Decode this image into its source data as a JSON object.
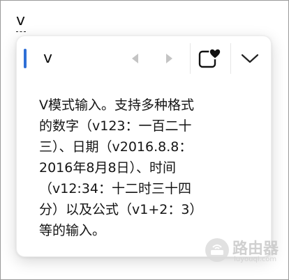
{
  "composition": {
    "text": "v"
  },
  "candidate": {
    "text": "v"
  },
  "description": "V模式输入。支持多种格式\n的数字（v123：一百二十\n三）、日期（v2016.8.8：\n2016年8月8日）、时间\n（v12:34：十二时三十四\n分）以及公式（v1+2：3）\n等的输入。",
  "icons": {
    "prev": "triangle-left-icon",
    "next": "triangle-right-icon",
    "favorite": "heart-box-icon",
    "expand": "chevron-down-icon",
    "watermark": "router-logo-icon"
  },
  "watermark": {
    "brand": "路由器",
    "sub": "luyouqi.com"
  },
  "colors": {
    "accent": "#2f6fd6",
    "disabled_arrow": "#c4c4c4",
    "text": "#141414"
  }
}
